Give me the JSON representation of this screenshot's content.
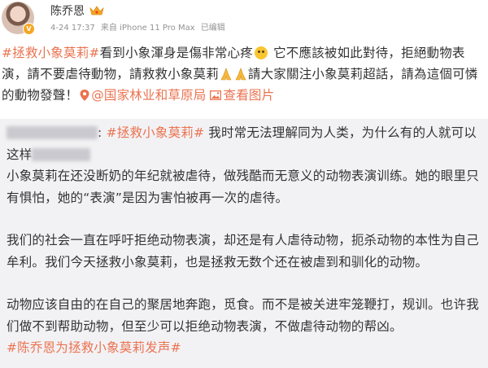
{
  "author": {
    "name": "陈乔恩",
    "verified_badge": "V",
    "timestamp": "4-24 17:37",
    "source": "来自 iPhone 11 Pro Max",
    "edited": "已编辑"
  },
  "post": {
    "tag1": "#拯救小象莫莉#",
    "text1": "看到小象渾身是傷非常心疼",
    "text2": " 它不應該被如此對待，拒絕動物表演，請不要虐待動物，請救救小象莫莉",
    "text3": "請大家關注小象莫莉超話，請為這個可憐的動物發聲！",
    "location_link": "@国家林业和草原局",
    "view_image_link": "查看图片",
    "icons": {
      "location": "location-pin-icon",
      "image": "image-icon",
      "emoji_sad": "sad-emoji-icon",
      "emoji_pray": "pray-emoji-icon"
    }
  },
  "repost": {
    "colon": ":",
    "tag": "#拯救小象莫莉#",
    "line1": " 我时常无法理解同为人类，为什么有的人就可以这样",
    "p1": "小象莫莉在还没断奶的年纪就被虐待，做残酷而无意义的动物表演训练。她的眼里只有惧怕，她的“表演”是因为害怕被再一次的虐待。",
    "p2": "我们的社会一直在呼吁拒绝动物表演，却还是有人虐待动物，扼杀动物的本性为自己牟利。我们今天拯救小象莫莉，也是拯救无数个还在被虐到和驯化的动物。",
    "p3": "动物应该自由的在自己的聚居地奔跑，觅食。而不是被关进牢笼鞭打，规训。也许我们做不到帮助动物，但至少可以拒绝动物表演，不做虐待动物的帮凶。",
    "tag_end": "#陈乔恩为拯救小象莫莉发声#"
  },
  "colors": {
    "accent": "#eb7350",
    "meta": "#939393",
    "quote_bg": "#f2f2f5"
  }
}
